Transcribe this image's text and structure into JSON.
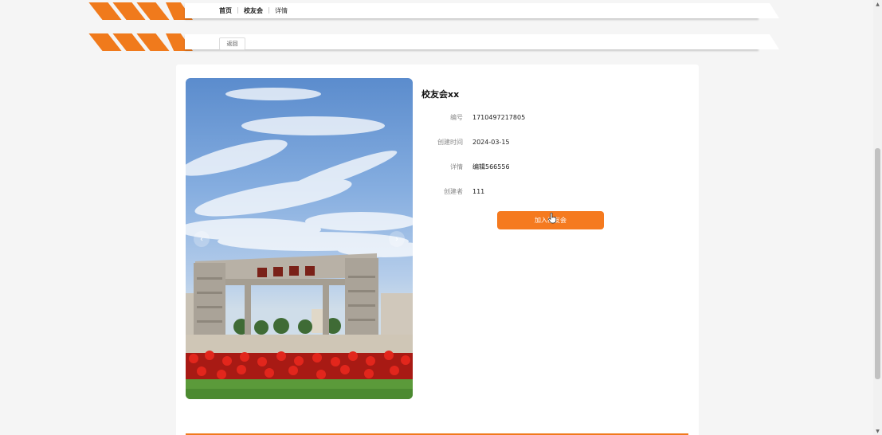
{
  "breadcrumb": {
    "home": "首页",
    "section": "校友会",
    "current": "详情"
  },
  "back_label": "返回",
  "detail": {
    "title": "校友会xx",
    "fields": [
      {
        "label": "编号",
        "value": "1710497217805"
      },
      {
        "label": "创建时间",
        "value": "2024-03-15"
      },
      {
        "label": "详情",
        "value": "编辑566556"
      },
      {
        "label": "创建者",
        "value": "111"
      }
    ],
    "join_label": "加入校友会"
  },
  "icons": {
    "prev": "chevron-left-icon",
    "next": "chevron-right-icon",
    "cursor": "hand-pointer-icon"
  },
  "colors": {
    "accent": "#f57a1f",
    "background": "#f5f5f5",
    "card": "#ffffff"
  }
}
